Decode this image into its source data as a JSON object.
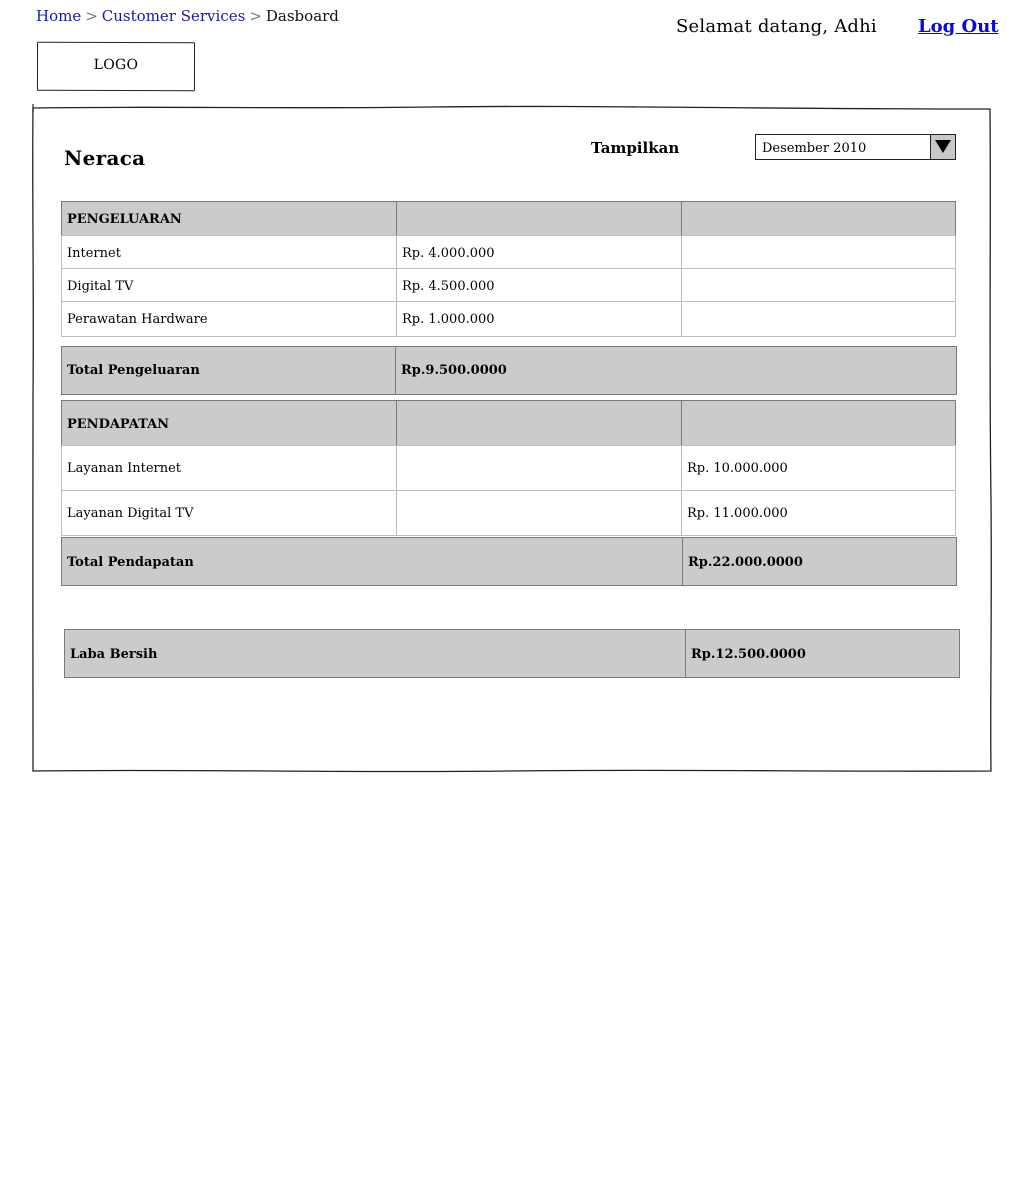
{
  "breadcrumb": {
    "items": [
      {
        "label": "Home"
      },
      {
        "label": "Customer Services"
      }
    ],
    "separator": ">",
    "current": "Dasboard"
  },
  "header": {
    "welcome": "Selamat datang, Adhi",
    "logout_label": "Log Out"
  },
  "logo": {
    "text": "LOGO"
  },
  "page": {
    "title": "Neraca",
    "filter": {
      "label": "Tampilkan",
      "selected": "Desember 2010"
    }
  },
  "expenses": {
    "header": "PENGELUARAN",
    "rows": [
      {
        "label": "Internet",
        "amount": "Rp. 4.000.000"
      },
      {
        "label": "Digital TV",
        "amount": "Rp. 4.500.000"
      },
      {
        "label": "Perawatan Hardware",
        "amount": "Rp. 1.000.000"
      }
    ],
    "total_label": "Total Pengeluaran",
    "total_value": "Rp.9.500.0000"
  },
  "income": {
    "header": "PENDAPATAN",
    "rows": [
      {
        "label": "Layanan Internet",
        "amount": "Rp. 10.000.000"
      },
      {
        "label": "Layanan Digital TV",
        "amount": "Rp. 11.000.000"
      }
    ],
    "total_label": "Total Pendapatan",
    "total_value": "Rp.22.000.0000"
  },
  "net_profit": {
    "label": "Laba Bersih",
    "value": "Rp.12.500.0000"
  },
  "colors": {
    "link": "#1a1aa6",
    "logout": "#0a0ad8",
    "header_fill": "#cbcbcb"
  }
}
